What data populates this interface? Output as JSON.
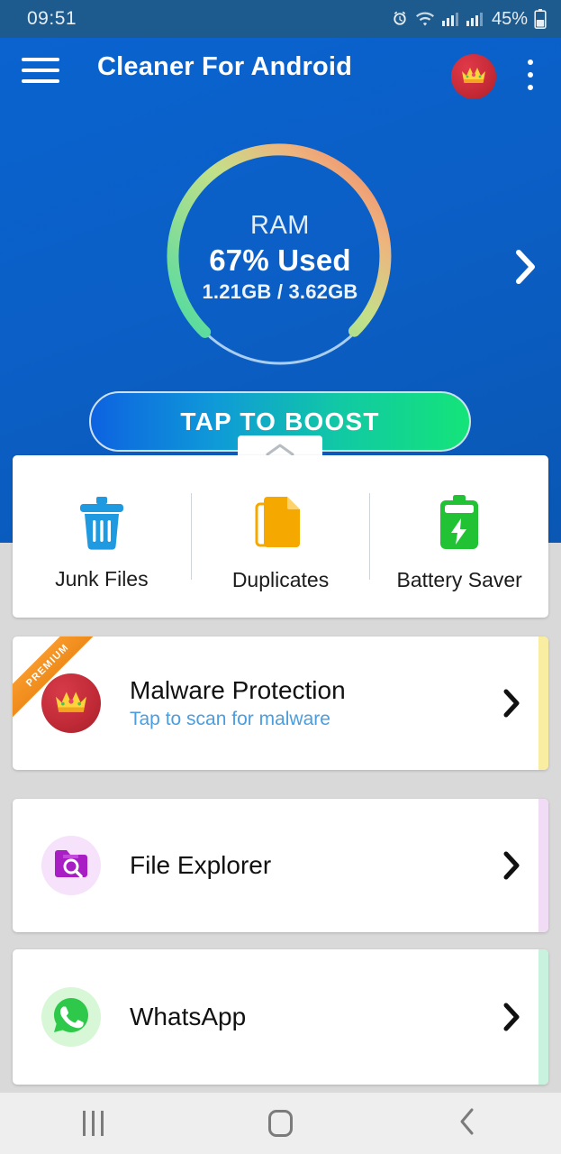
{
  "status_bar": {
    "clock": "09:51",
    "battery_percent": "45%",
    "icons": [
      "alarm-icon",
      "wifi-icon",
      "signal-sim1-icon",
      "signal-sim2-icon",
      "battery-icon"
    ]
  },
  "app_bar": {
    "title": "Cleaner For Android",
    "menu_icon": "hamburger-menu-icon",
    "premium_icon": "crown-icon",
    "overflow_icon": "more-vertical-icon"
  },
  "ram_widget": {
    "label": "RAM",
    "percent_text": "67% Used",
    "detail": "1.21GB / 3.62GB",
    "percent_value": 67,
    "used_gb": "1.21GB",
    "total_gb": "3.62GB",
    "next_icon": "chevron-right-icon",
    "ring_start_color": "#4ddba0",
    "ring_mid_color": "#bee08a",
    "ring_end_color": "#f08a6b",
    "ring_track_color": "#9ec9ee"
  },
  "boost": {
    "label": "TAP TO BOOST",
    "gradient_start": "#0d62e0",
    "gradient_end": "#14e479"
  },
  "pager": {
    "dots": [
      "active",
      "inactive"
    ]
  },
  "sheet_handle": {
    "icon": "chevron-up-icon"
  },
  "tools": [
    {
      "label": "Junk Files",
      "icon": "trash-icon",
      "color": "#1f9ae0"
    },
    {
      "label": "Duplicates",
      "icon": "duplicate-files-icon",
      "color": "#f5a800"
    },
    {
      "label": "Battery Saver",
      "icon": "battery-bolt-icon",
      "color": "#21c334"
    }
  ],
  "rows": [
    {
      "title": "Malware Protection",
      "subtitle": "Tap to scan for malware",
      "icon": "crown-icon",
      "avatar_color": "#c62a36",
      "edge_color": "#f9eda2",
      "ribbon": "PREMIUM",
      "chevron": "chevron-right-icon"
    },
    {
      "title": "File Explorer",
      "subtitle": "",
      "icon": "folder-search-icon",
      "avatar_color": "#f5e1f8",
      "edge_color": "#f0dcf5",
      "chevron": "chevron-right-icon"
    },
    {
      "title": "WhatsApp",
      "subtitle": "",
      "icon": "whatsapp-icon",
      "avatar_color": "#d9f7d9",
      "edge_color": "#c8f2dd",
      "chevron": "chevron-right-icon"
    }
  ],
  "nav_bar": {
    "recents": "recents-icon",
    "home": "home-icon",
    "back": "back-icon"
  }
}
